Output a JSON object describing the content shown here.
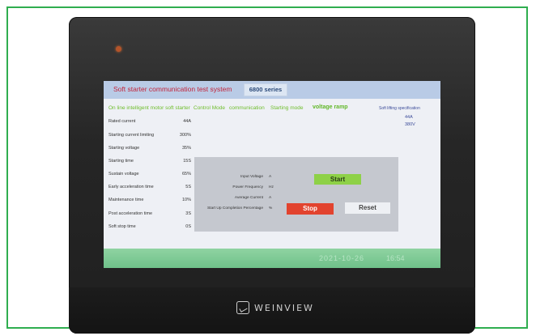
{
  "screen": {
    "title": "Soft starter communication test system",
    "series_button": "6800 series"
  },
  "menu": {
    "online_label": "On line intelligent motor soft starter",
    "control_mode": "Control Mode",
    "communication": "communication",
    "starting_mode": "Starting mode",
    "voltage_ramp": "voltage ramp",
    "spec_label": "Soft lifting specification",
    "spec_current": "44A",
    "spec_voltage": "380V"
  },
  "parameters": [
    {
      "label": "Rated current",
      "value": "44A"
    },
    {
      "label": "Starting current limiting",
      "value": "300%"
    },
    {
      "label": "Starting voltage",
      "value": "35%"
    },
    {
      "label": "Starting time",
      "value": "15S"
    },
    {
      "label": "Sustain voltage",
      "value": "65%"
    },
    {
      "label": "Early acceleration time",
      "value": "5S"
    },
    {
      "label": "Maintenance time",
      "value": "10%"
    },
    {
      "label": "Post acceleration time",
      "value": "3S"
    },
    {
      "label": "Soft stop time",
      "value": "0S"
    }
  ],
  "readouts": [
    {
      "label": "Input Voltage",
      "unit": "A"
    },
    {
      "label": "Power Frequency",
      "unit": "Hz"
    },
    {
      "label": "Average Current",
      "unit": "A"
    },
    {
      "label": "Start Up Completion Percentage",
      "unit": "%"
    }
  ],
  "buttons": {
    "start": "Start",
    "stop": "Stop",
    "reset": "Reset"
  },
  "footer": {
    "date": "2021-10-26",
    "time": "16:54"
  },
  "brand": {
    "name": "WEINVIEW"
  },
  "colors": {
    "title_red": "#c2243b",
    "menu_green": "#6ebd2b",
    "start_green": "#8ed147",
    "stop_red": "#e2432e",
    "footer_green": "#7cc796"
  }
}
